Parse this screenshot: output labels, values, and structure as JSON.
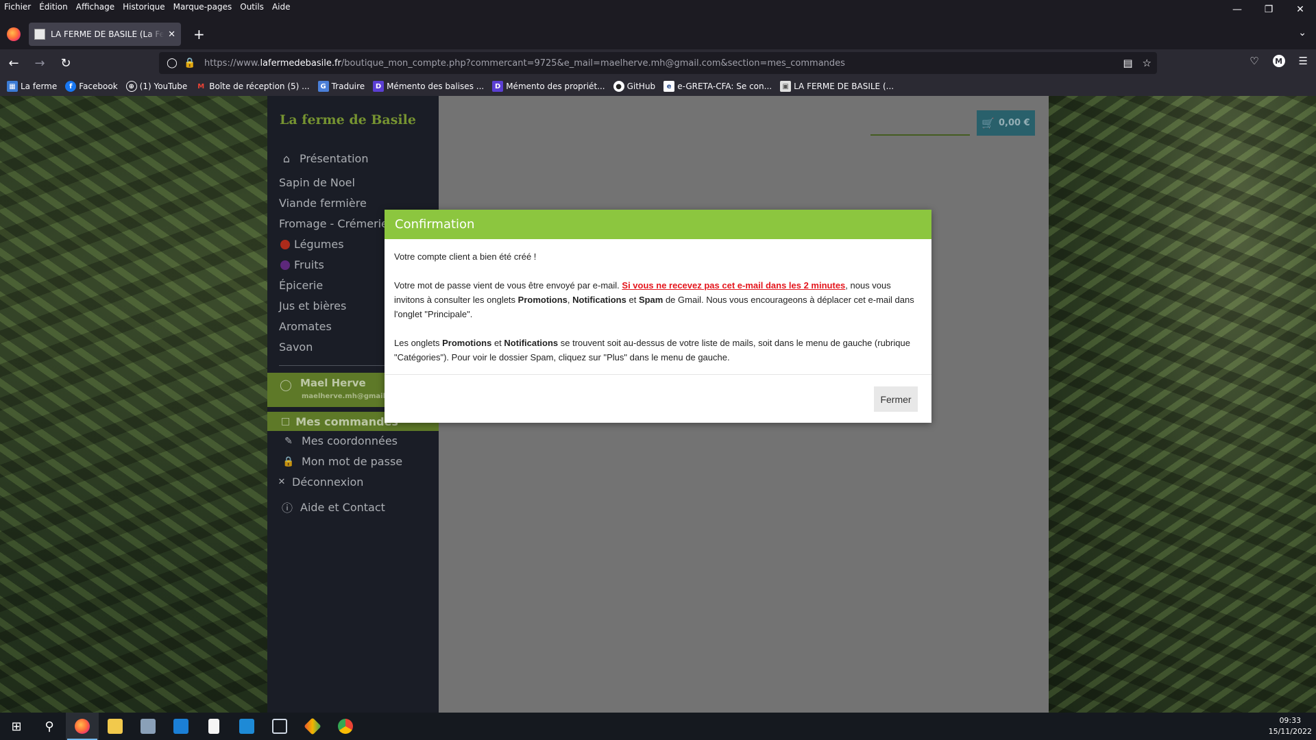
{
  "browser": {
    "menu": [
      "Fichier",
      "Édition",
      "Affichage",
      "Historique",
      "Marque-pages",
      "Outils",
      "Aide"
    ],
    "tab_title": "LA FERME DE BASILE (La Ferme de Basile)",
    "url_prefix": "https://www.",
    "url_domain": "lafermedebasile.fr",
    "url_path": "/boutique_mon_compte.php?commercant=9725&e_mail=maelherve.mh@gmail.com&section=mes_commandes",
    "profile_initial": "M",
    "bookmarks": [
      {
        "label": "La ferme",
        "icon": "grid-icon",
        "color": "#3b7bd4"
      },
      {
        "label": "Facebook",
        "icon": "facebook-icon",
        "color": "#1877f2"
      },
      {
        "label": "(1) YouTube",
        "icon": "globe-icon",
        "color": "#555"
      },
      {
        "label": "Boîte de réception (5) ...",
        "icon": "gmail-icon",
        "color": "#ea4335"
      },
      {
        "label": "Traduire",
        "icon": "translate-icon",
        "color": "#4a7fd8"
      },
      {
        "label": "Mémento des balises ...",
        "icon": "memento-icon",
        "color": "#5b3fd4"
      },
      {
        "label": "Mémento des propriét...",
        "icon": "memento-icon",
        "color": "#5b3fd4"
      },
      {
        "label": "GitHub",
        "icon": "github-icon",
        "color": "#444"
      },
      {
        "label": "e-GRETA-CFA: Se con...",
        "icon": "greta-icon",
        "color": "#2a4e8f"
      },
      {
        "label": "LA FERME DE BASILE (...",
        "icon": "page-icon",
        "color": "#ddd"
      }
    ]
  },
  "site": {
    "logo": "La ferme de Basile",
    "nav": [
      {
        "label": "Présentation",
        "icon": "home-icon"
      },
      {
        "label": "Sapin de Noel"
      },
      {
        "label": "Viande fermière"
      },
      {
        "label": "Fromage - Crémerie"
      },
      {
        "label": "Légumes",
        "icon": "tomato-icon",
        "dot_color": "#c4321f"
      },
      {
        "label": "Fruits",
        "icon": "grape-icon",
        "dot_color": "#6a2e8c"
      },
      {
        "label": "Épicerie"
      },
      {
        "label": "Jus et bières"
      },
      {
        "label": "Aromates"
      },
      {
        "label": "Savon"
      }
    ],
    "user": {
      "name": "Mael Herve",
      "email": "maelherve.mh@gmail.com"
    },
    "account_menu": {
      "active": "Mes commandes",
      "items": [
        "Mes coordonnées",
        "Mon mot de passe",
        "Déconnexion"
      ],
      "help": "Aide et Contact"
    },
    "cart": "0,00 €"
  },
  "modal": {
    "title": "Confirmation",
    "line1": "Votre compte client a bien été créé !",
    "p2_start": "Votre mot de passe vient de vous être envoyé par e-mail. ",
    "p2_warning": "Si vous ne recevez pas cet e-mail dans les 2 minutes",
    "p2_mid1": ", nous vous invitons à consulter les onglets ",
    "promotions": "Promotions",
    "sep_comma": ", ",
    "notifications": "Notifications",
    "and": " et ",
    "spam": "Spam",
    "p2_end": " de Gmail. Nous vous encourageons à déplacer cet e-mail dans l'onglet \"Principale\".",
    "p3_start": "Les onglets ",
    "p3_end": " se trouvent soit au-dessus de votre liste de mails, soit dans le menu de gauche (rubrique \"Catégories\"). Pour voir le dossier Spam, cliquez sur \"Plus\" dans le menu de gauche.",
    "close_button": "Fermer"
  },
  "taskbar": {
    "time": "09:33",
    "date": "15/11/2022"
  }
}
